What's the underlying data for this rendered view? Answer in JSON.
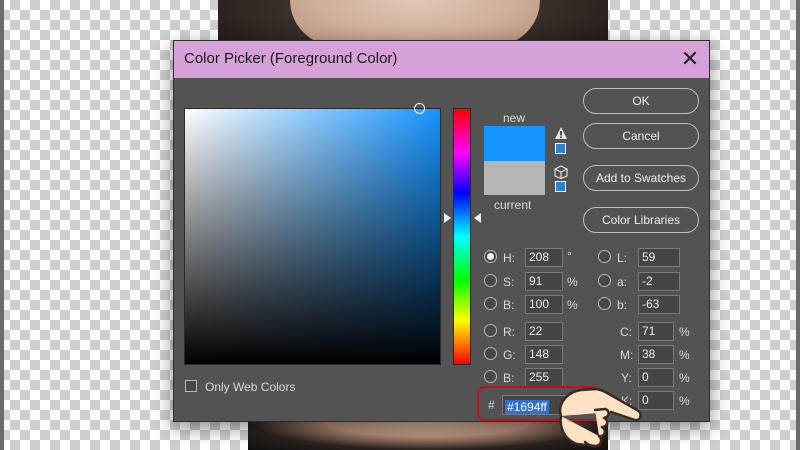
{
  "dialog": {
    "title": "Color Picker (Foreground Color)"
  },
  "colors": {
    "new_color": "#1694ff",
    "current_color": "#b5b5b5",
    "titlebar": "#d6a0d9",
    "highlight_border": "#c0101a"
  },
  "swatch": {
    "new_label": "new",
    "current_label": "current"
  },
  "buttons": {
    "ok": "OK",
    "cancel": "Cancel",
    "add_to_swatches": "Add to Swatches",
    "color_libraries": "Color Libraries"
  },
  "hsb": {
    "h_label": "H:",
    "h_value": "208",
    "h_unit": "°",
    "s_label": "S:",
    "s_value": "91",
    "s_unit": "%",
    "b_label": "B:",
    "b_value": "100",
    "b_unit": "%"
  },
  "rgb": {
    "r_label": "R:",
    "r_value": "22",
    "g_label": "G:",
    "g_value": "148",
    "b_label": "B:",
    "b_value": "255"
  },
  "lab": {
    "l_label": "L:",
    "l_value": "59",
    "a_label": "a:",
    "a_value": "-2",
    "b_label": "b:",
    "b_value": "-63"
  },
  "cmyk": {
    "c_label": "C:",
    "c_value": "71",
    "c_unit": "%",
    "m_label": "M:",
    "m_value": "38",
    "m_unit": "%",
    "y_label": "Y:",
    "y_value": "0",
    "y_unit": "%",
    "k_label": "K:",
    "k_value": "0",
    "k_unit": "%"
  },
  "hex": {
    "hash": "#",
    "value": "#1694ff"
  },
  "web_colors": {
    "label": "Only Web Colors"
  },
  "selected_mode": "H",
  "icons": [
    "close-icon",
    "warning-icon",
    "cube-icon",
    "pointing-hand-icon"
  ]
}
